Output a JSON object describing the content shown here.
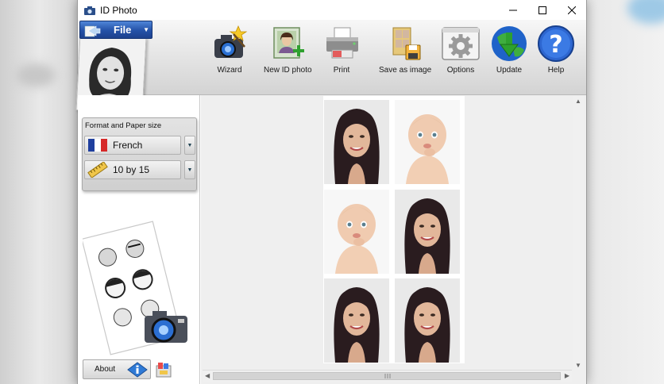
{
  "window": {
    "title": "ID Photo",
    "controls": [
      "minimize",
      "maximize",
      "close"
    ]
  },
  "toolbar": {
    "file_label": "File",
    "items": [
      {
        "label": "Wizard",
        "icon": "wizard-camera-icon"
      },
      {
        "label": "New ID photo",
        "icon": "new-id-photo-icon"
      },
      {
        "label": "Print",
        "icon": "printer-icon"
      },
      {
        "label": "Save as image",
        "icon": "save-as-image-icon"
      },
      {
        "label": "Options",
        "icon": "gear-icon"
      },
      {
        "label": "Update",
        "icon": "globe-download-icon"
      },
      {
        "label": "Help",
        "icon": "help-icon"
      }
    ]
  },
  "format": {
    "title": "Format and Paper size",
    "format_value": "French",
    "paper_value": "10 by 15"
  },
  "left": {
    "about_label": "About"
  },
  "preview": {
    "photos": [
      {
        "subject": "woman"
      },
      {
        "subject": "baby"
      },
      {
        "subject": "baby"
      },
      {
        "subject": "woman"
      },
      {
        "subject": "woman"
      },
      {
        "subject": "woman"
      }
    ]
  },
  "colors": {
    "file_button": "#2451a7",
    "toolbar_bg": "#e6e6e6",
    "preview_bg": "#efefef"
  }
}
